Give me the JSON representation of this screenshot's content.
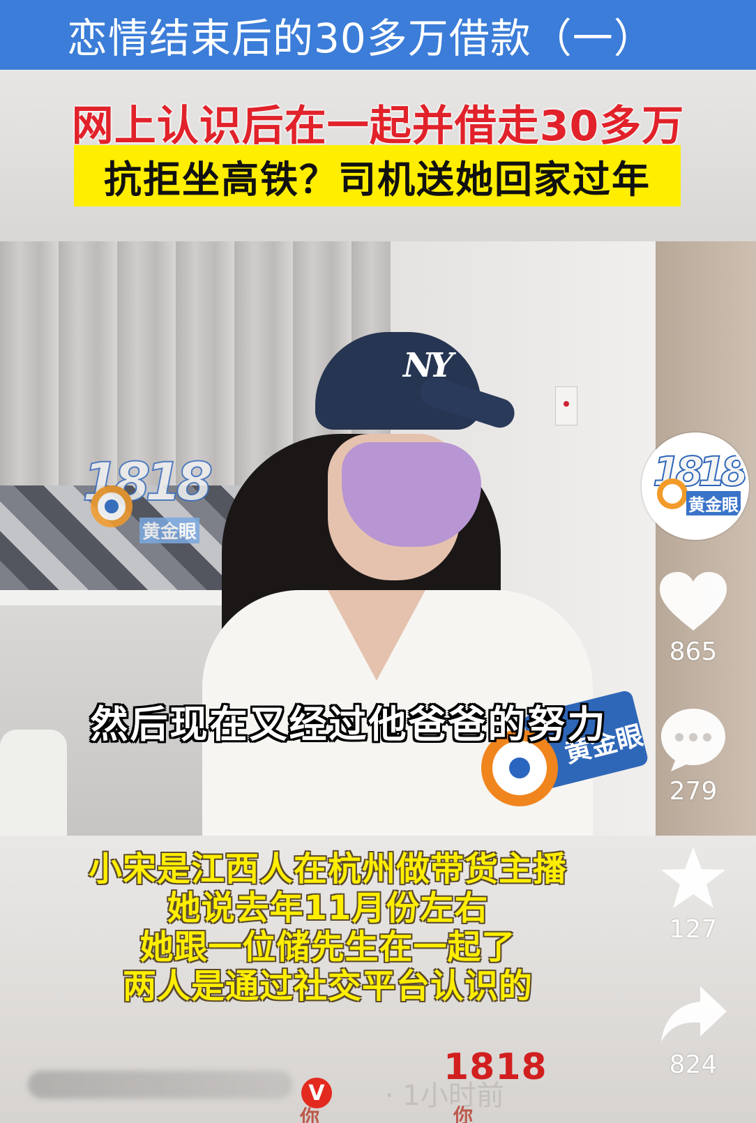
{
  "title_bar": {
    "title": "恋情结束后的30多万借款（一）"
  },
  "header": {
    "headline_red": "网上认识后在一起并借走30多万",
    "headline_yellow": "抗拒坐高铁？司机送她回家过年"
  },
  "video": {
    "cap_logo": "NY",
    "station_logo_number": "1818",
    "station_logo_name": "黄金眼",
    "mic_label": "黄金眼",
    "subtitle": "然后现在又经过他爸爸的努力"
  },
  "caption": {
    "lines": [
      "小宋是江西人在杭州做带货主播",
      "她说去年11月份左右",
      "她跟一位储先生在一起了",
      "两人是通过社交平台认识的"
    ],
    "mark_1818": "1818",
    "time_ago": "· 1小时前",
    "verified_badge": "V",
    "watermark_ni": "你"
  },
  "sidebar": {
    "avatar_number": "1818",
    "avatar_name": "黄金眼",
    "like_count": "865",
    "comment_count": "279",
    "favorite_count": "127",
    "share_count": "824"
  },
  "colors": {
    "title_bar": "#3b7dd8",
    "headline_red": "#e1222a",
    "headline_yellow_bg": "#ffee00",
    "caption_yellow": "#ffee00",
    "mark_red": "#d11f1f"
  }
}
